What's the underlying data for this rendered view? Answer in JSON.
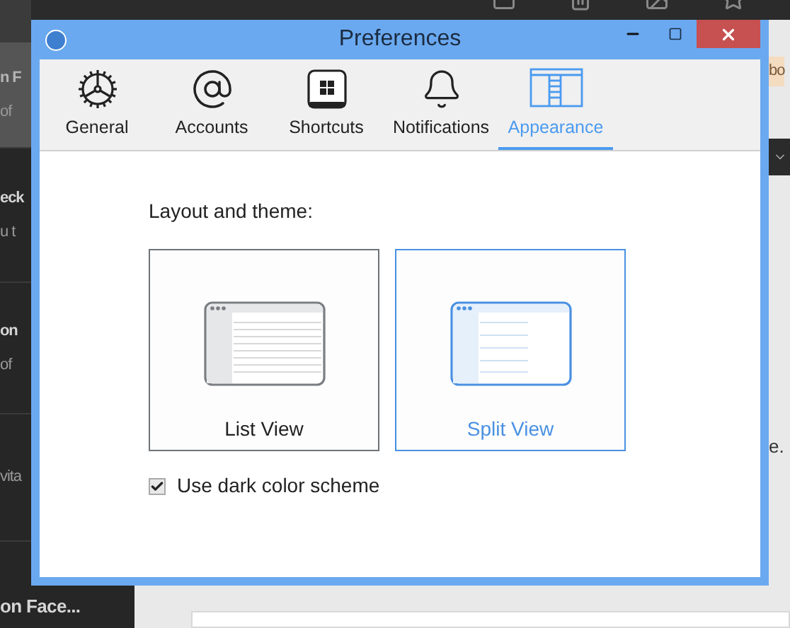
{
  "background": {
    "sidebar_items": [
      {
        "title": "n F",
        "subtitle": "of",
        "selected": true
      },
      {
        "title": "eck",
        "subtitle": "u t",
        "selected": false
      },
      {
        "title": "on",
        "subtitle": "of",
        "selected": false
      },
      {
        "subtitle": "vita",
        "selected": false
      }
    ],
    "sidebar_bottom": "on Face...",
    "right_badge": "bo",
    "right_text": "e."
  },
  "window": {
    "title": "Preferences"
  },
  "tabs": [
    {
      "label": "General",
      "selected": false
    },
    {
      "label": "Accounts",
      "selected": false
    },
    {
      "label": "Shortcuts",
      "selected": false
    },
    {
      "label": "Notifications",
      "selected": false
    },
    {
      "label": "Appearance",
      "selected": true
    }
  ],
  "layout_label": "Layout and theme:",
  "views": [
    {
      "label": "List View",
      "kind": "list",
      "selected": false
    },
    {
      "label": "Split View",
      "kind": "split",
      "selected": true
    }
  ],
  "dark_scheme": {
    "label": "Use dark color scheme",
    "checked": true
  }
}
